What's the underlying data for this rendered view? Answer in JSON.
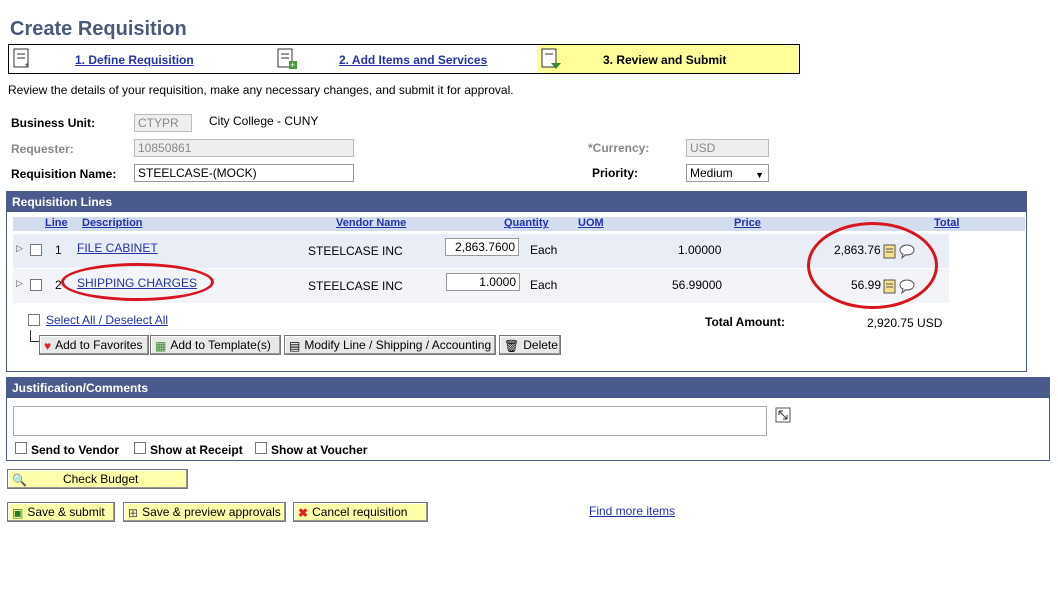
{
  "page_title": "Create Requisition",
  "train": {
    "step1": "1. Define Requisition",
    "step2": "2. Add Items and Services",
    "step3": "3. Review and Submit"
  },
  "instructions": "Review the details of your requisition, make any necessary changes, and submit it for approval.",
  "header": {
    "business_unit_label": "Business Unit:",
    "business_unit_value": "CTYPR",
    "business_unit_desc": "City College - CUNY",
    "requester_label": "Requester:",
    "requester_value": "10850861",
    "requisition_name_label": "Requisition Name:",
    "requisition_name_value": "STEELCASE-(MOCK)",
    "currency_label": "*Currency:",
    "currency_value": "USD",
    "priority_label": "Priority:",
    "priority_value": "Medium"
  },
  "lines_grid": {
    "title": "Requisition Lines",
    "columns": {
      "line": "Line",
      "description": "Description",
      "vendor": "Vendor Name",
      "quantity": "Quantity",
      "uom": "UOM",
      "price": "Price",
      "total": "Total"
    },
    "rows": [
      {
        "line": "1",
        "description": "FILE CABINET",
        "vendor": "STEELCASE INC",
        "quantity": "2,863.7600",
        "uom": "Each",
        "price": "1.00000",
        "total": "2,863.76"
      },
      {
        "line": "2",
        "description": "SHIPPING CHARGES",
        "vendor": "STEELCASE INC",
        "quantity": "1.0000",
        "uom": "Each",
        "price": "56.99000",
        "total": "56.99"
      }
    ],
    "select_all": "Select All / Deselect All",
    "total_amount_label": "Total Amount:",
    "total_amount_value": "2,920.75 USD",
    "buttons": {
      "favorites": "Add to Favorites",
      "template": "Add to Template(s)",
      "modify": "Modify Line / Shipping / Accounting",
      "delete": "Delete"
    }
  },
  "comments": {
    "title": "Justification/Comments",
    "send_to_vendor": "Send to Vendor",
    "show_at_receipt": "Show at Receipt",
    "show_at_voucher": "Show at Voucher"
  },
  "actions": {
    "check_budget": "Check Budget",
    "save_submit": "Save & submit",
    "save_preview": "Save & preview approvals",
    "cancel": "Cancel requisition",
    "find_more": "Find more items"
  },
  "colors": {
    "accent": "#4a5a8c",
    "link": "#2233aa",
    "highlight": "#ffff99",
    "annotation": "#d8141e"
  }
}
